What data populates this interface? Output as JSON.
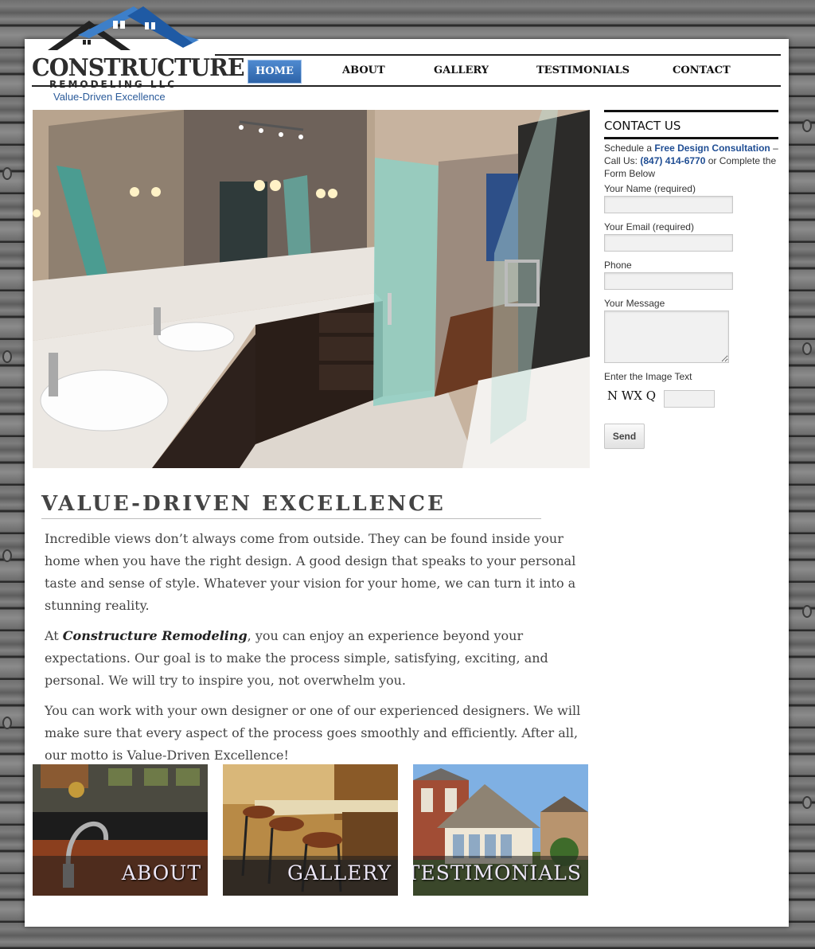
{
  "brand": {
    "name": "CONSTRUCTURE",
    "subname": "REMODELING LLC",
    "tagline": "Value-Driven Excellence"
  },
  "nav": {
    "items": [
      {
        "label": "HOME",
        "active": true
      },
      {
        "label": "ABOUT",
        "active": false
      },
      {
        "label": "GALLERY",
        "active": false
      },
      {
        "label": "TESTIMONIALS",
        "active": false
      },
      {
        "label": "CONTACT",
        "active": false
      }
    ]
  },
  "sidebar": {
    "title": "CONTACT US",
    "intro_prefix": "Schedule a ",
    "intro_link": "Free Design Consultation",
    "intro_mid": " – Call Us: ",
    "phone": "(847) 414-6770",
    "intro_suffix": " or Complete the Form Below",
    "fields": {
      "name_label": "Your Name (required)",
      "email_label": "Your Email (required)",
      "phone_label": "Phone",
      "message_label": "Your Message",
      "captcha_label": "Enter the Image Text",
      "captcha_text": "N WX Q"
    },
    "send_label": "Send"
  },
  "main": {
    "heading": "VALUE-DRIVEN EXCELLENCE",
    "p1": "Incredible views don’t always come from outside. They can be found inside your home when you have the right design. A good design that speaks to your personal taste and sense of style. Whatever your vision for your home, we can turn it into a stunning reality.",
    "p2_prefix": "At ",
    "p2_brand": "Constructure Remodeling",
    "p2_suffix": ", you can enjoy an experience beyond your expectations. Our goal is to make the process simple, satisfying, exciting, and personal. We will try to inspire you, not overwhelm you.",
    "p3": "You can work with your own designer or one of our experienced designers. We will make sure that every aspect of the process goes smoothly and efficiently. After all, our motto is Value-Driven Excellence!"
  },
  "tiles": [
    {
      "label": "ABOUT"
    },
    {
      "label": "GALLERY"
    },
    {
      "label": "TESTIMONIALS"
    }
  ],
  "colors": {
    "accent_blue": "#2d63a8",
    "link_blue": "#1f4d93",
    "text_gray": "#444444"
  }
}
